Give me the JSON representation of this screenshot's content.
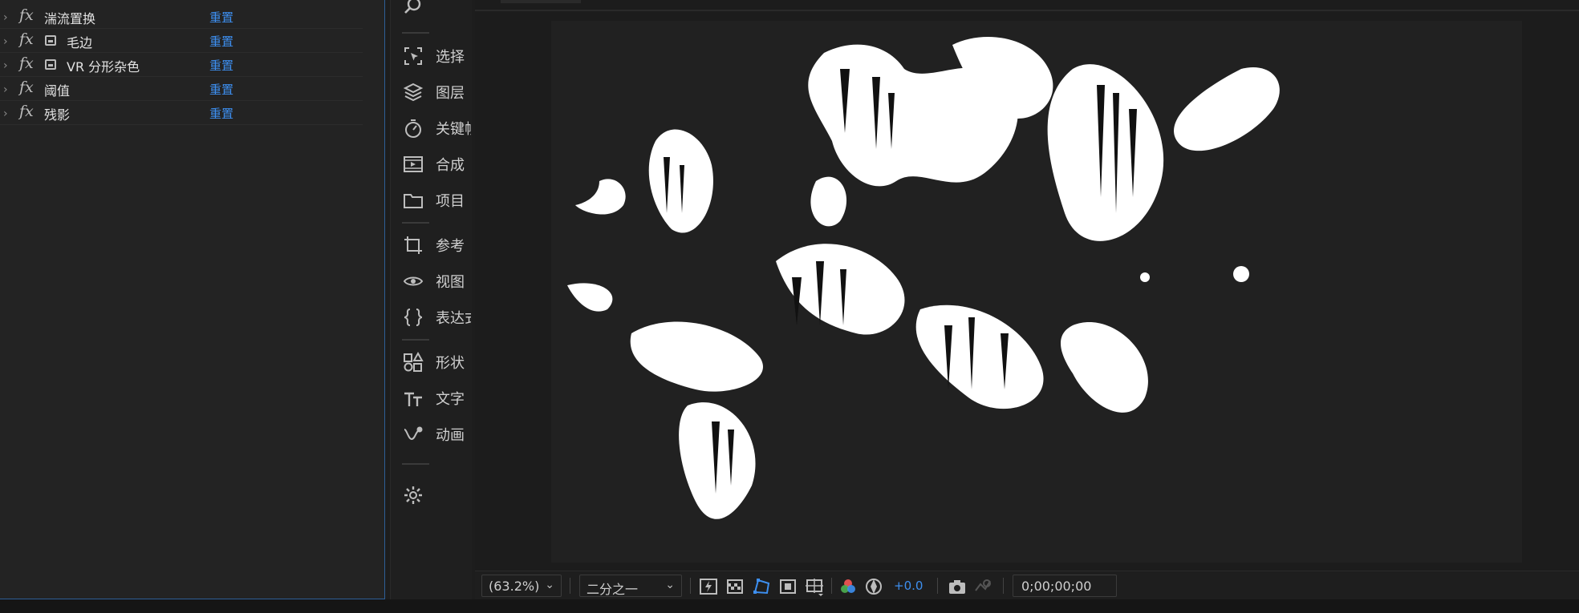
{
  "effects": [
    {
      "name": "湍流置换",
      "reset": "重置",
      "icon": "fx-icon"
    },
    {
      "name": "毛边",
      "reset": "重置",
      "icon": "fx-icon",
      "effect_icon": "plugin-icon"
    },
    {
      "name": "VR 分形杂色",
      "reset": "重置",
      "icon": "fx-icon",
      "effect_icon": "plugin-icon"
    },
    {
      "name": "阈值",
      "reset": "重置",
      "icon": "fx-icon"
    },
    {
      "name": "残影",
      "reset": "重置",
      "icon": "fx-icon"
    }
  ],
  "tools": [
    {
      "label": "选择",
      "icon": "select-icon"
    },
    {
      "label": "图层",
      "icon": "layers-icon"
    },
    {
      "label": "关键帧",
      "icon": "stopwatch-icon"
    },
    {
      "label": "合成",
      "icon": "composition-icon"
    },
    {
      "label": "项目",
      "icon": "folder-icon"
    },
    {
      "label": "参考",
      "icon": "crop-icon"
    },
    {
      "label": "视图",
      "icon": "eye-icon"
    },
    {
      "label": "表达式",
      "icon": "braces-icon"
    },
    {
      "label": "形状",
      "icon": "shapes-icon"
    },
    {
      "label": "文字",
      "icon": "text-tool-icon"
    },
    {
      "label": "动画",
      "icon": "pen-animate-icon"
    }
  ],
  "viewer": {
    "zoom": "(63.2%)",
    "resolution": "二分之一",
    "exposure": "+0.0",
    "timecode": "0;00;00;00"
  },
  "colors": {
    "accent": "#3d8ff0",
    "panel_border": "#2e5f97",
    "background": "#1d1d1d"
  }
}
